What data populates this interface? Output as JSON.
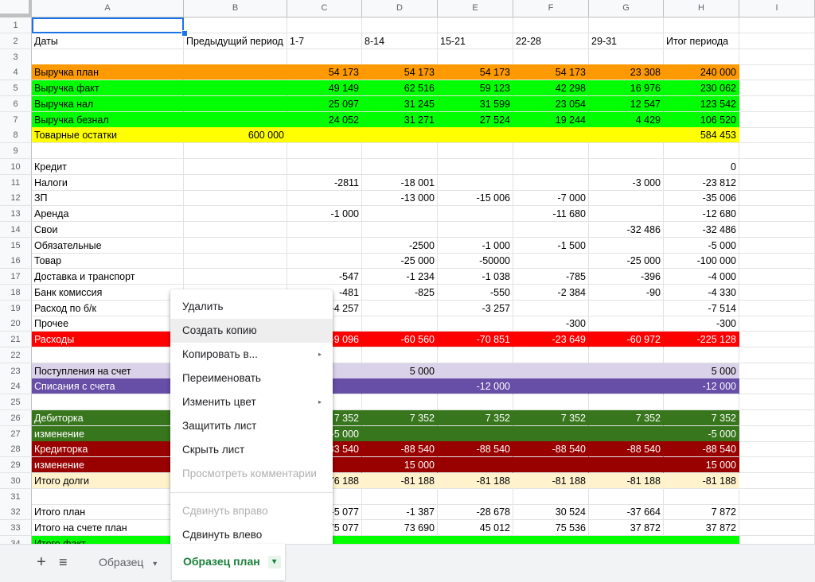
{
  "columns": [
    "A",
    "B",
    "C",
    "D",
    "E",
    "F",
    "G",
    "H",
    "I"
  ],
  "rows": [
    {
      "n": "1",
      "cells": [
        "",
        "",
        "",
        "",
        "",
        "",
        "",
        ""
      ]
    },
    {
      "n": "2",
      "cells": [
        "Даты",
        "Предыдущий период",
        "1-7",
        "8-14",
        "15-21",
        "22-28",
        "29-31",
        "Итог периода"
      ]
    },
    {
      "n": "3",
      "cells": [
        "",
        "",
        "",
        "",
        "",
        "",
        "",
        ""
      ]
    },
    {
      "n": "4",
      "cells": [
        "Выручка план",
        "",
        "54 173",
        "54 173",
        "54 173",
        "54 173",
        "23 308",
        "240 000"
      ],
      "fill": "#ff9900"
    },
    {
      "n": "5",
      "cells": [
        "Выручка факт",
        "",
        "49 149",
        "62 516",
        "59 123",
        "42 298",
        "16 976",
        "230 062"
      ],
      "fill": "#00ff00"
    },
    {
      "n": "6",
      "cells": [
        "Выручка нал",
        "",
        "25 097",
        "31 245",
        "31 599",
        "23 054",
        "12 547",
        "123 542"
      ],
      "fill": "#00ff00"
    },
    {
      "n": "7",
      "cells": [
        "Выручка безнал",
        "",
        "24 052",
        "31 271",
        "27 524",
        "19 244",
        "4 429",
        "106 520"
      ],
      "fill": "#00ff00"
    },
    {
      "n": "8",
      "cells": [
        "Товарные остатки",
        "600 000",
        "",
        "",
        "",
        "",
        "",
        "584 453"
      ],
      "fill": "#ffff00"
    },
    {
      "n": "9",
      "cells": [
        "",
        "",
        "",
        "",
        "",
        "",
        "",
        ""
      ]
    },
    {
      "n": "10",
      "cells": [
        "Кредит",
        "",
        "",
        "",
        "",
        "",
        "",
        "0"
      ]
    },
    {
      "n": "11",
      "cells": [
        "Налоги",
        "",
        "-2811",
        "-18 001",
        "",
        "",
        "-3 000",
        "-23 812"
      ]
    },
    {
      "n": "12",
      "cells": [
        "ЗП",
        "",
        "",
        "-13 000",
        "-15 006",
        "-7 000",
        "",
        "-35 006"
      ]
    },
    {
      "n": "13",
      "cells": [
        "Аренда",
        "",
        "-1 000",
        "",
        "",
        "-11 680",
        "",
        "-12 680"
      ]
    },
    {
      "n": "14",
      "cells": [
        "Свои",
        "",
        "",
        "",
        "",
        "",
        "-32 486",
        "-32 486"
      ]
    },
    {
      "n": "15",
      "cells": [
        "Обязательные",
        "",
        "",
        "-2500",
        "-1 000",
        "-1 500",
        "",
        "-5 000"
      ]
    },
    {
      "n": "16",
      "cells": [
        "Товар",
        "",
        "",
        "-25 000",
        "-50000",
        "",
        "-25 000",
        "-100 000"
      ]
    },
    {
      "n": "17",
      "cells": [
        "Доставка и транспорт",
        "",
        "-547",
        "-1 234",
        "-1 038",
        "-785",
        "-396",
        "-4 000"
      ]
    },
    {
      "n": "18",
      "cells": [
        "Банк комиссия",
        "",
        "-481",
        "-825",
        "-550",
        "-2 384",
        "-90",
        "-4 330"
      ]
    },
    {
      "n": "19",
      "cells": [
        "Расход по б/к",
        "",
        "-4 257",
        "",
        "-3 257",
        "",
        "",
        "-7 514"
      ]
    },
    {
      "n": "20",
      "cells": [
        "Прочее",
        "",
        "",
        "",
        "",
        "-300",
        "",
        "-300"
      ]
    },
    {
      "n": "21",
      "cells": [
        "Расходы",
        "",
        "-9 096",
        "-60 560",
        "-70 851",
        "-23 649",
        "-60 972",
        "-225 128"
      ],
      "fill": "#ff0000"
    },
    {
      "n": "22",
      "cells": [
        "",
        "",
        "",
        "",
        "",
        "",
        "",
        ""
      ]
    },
    {
      "n": "23",
      "cells": [
        "Поступления на счет",
        "",
        "",
        "5 000",
        "",
        "",
        "",
        "5 000"
      ],
      "fill": "#d9d2e9"
    },
    {
      "n": "24",
      "cells": [
        "Списания с счета",
        "",
        "",
        "",
        "-12 000",
        "",
        "",
        "-12 000"
      ],
      "fill": "#674ea7"
    },
    {
      "n": "25",
      "cells": [
        "",
        "",
        "",
        "",
        "",
        "",
        "",
        ""
      ]
    },
    {
      "n": "26",
      "cells": [
        "Дебиторка",
        "",
        "7 352",
        "7 352",
        "7 352",
        "7 352",
        "7 352",
        "7 352"
      ],
      "fill": "#38761d"
    },
    {
      "n": "27",
      "cells": [
        "изменение",
        "",
        "-5 000",
        "",
        "",
        "",
        "",
        "-5 000"
      ],
      "fill": "#38761d"
    },
    {
      "n": "28",
      "cells": [
        "Кредиторка",
        "",
        "-83 540",
        "-88 540",
        "-88 540",
        "-88 540",
        "-88 540",
        "-88 540"
      ],
      "fill": "#990000"
    },
    {
      "n": "29",
      "cells": [
        "изменение",
        "",
        "",
        "15 000",
        "",
        "",
        "",
        "15 000"
      ],
      "fill": "#990000"
    },
    {
      "n": "30",
      "cells": [
        "Итого долги",
        "",
        "-76 188",
        "-81 188",
        "-81 188",
        "-81 188",
        "-81 188",
        "-81 188"
      ],
      "fill": "#fff2cc"
    },
    {
      "n": "31",
      "cells": [
        "",
        "",
        "",
        "",
        "",
        "",
        "",
        ""
      ]
    },
    {
      "n": "32",
      "cells": [
        "Итого план",
        "",
        "-5 077",
        "-1 387",
        "-28 678",
        "30 524",
        "-37 664",
        "7 872"
      ]
    },
    {
      "n": "33",
      "cells": [
        "Итого на счете план",
        "",
        "75 077",
        "73 690",
        "45 012",
        "75 536",
        "37 872",
        "37 872"
      ]
    },
    {
      "n": "34",
      "cells": [
        "Итого факт",
        "",
        "",
        "",
        "",
        "",
        "",
        ""
      ],
      "fill": "#00ff00"
    }
  ],
  "context_menu": {
    "items": [
      {
        "label": "Удалить",
        "disabled": false,
        "submenu": false
      },
      {
        "label": "Создать копию",
        "disabled": false,
        "submenu": false,
        "hover": true
      },
      {
        "label": "Копировать в...",
        "disabled": false,
        "submenu": true
      },
      {
        "label": "Переименовать",
        "disabled": false,
        "submenu": false
      },
      {
        "label": "Изменить цвет",
        "disabled": false,
        "submenu": true
      },
      {
        "label": "Защитить лист",
        "disabled": false,
        "submenu": false
      },
      {
        "label": "Скрыть лист",
        "disabled": false,
        "submenu": false
      },
      {
        "label": "Просмотреть комментарии",
        "disabled": true,
        "submenu": false
      },
      {
        "label": "Сдвинуть вправо",
        "disabled": true,
        "submenu": false
      },
      {
        "label": "Сдвинуть влево",
        "disabled": false,
        "submenu": false
      }
    ],
    "submenu_arrow": "▸"
  },
  "tabs": {
    "add_symbol": "+",
    "list_symbol": "≡",
    "sheets": [
      {
        "label": "Образец",
        "active": false
      },
      {
        "label": "Образец план",
        "active": true
      }
    ],
    "dropdown_symbol": "▾"
  },
  "colors": {
    "accent": "#1a73e8",
    "active_tab": "#188038"
  }
}
